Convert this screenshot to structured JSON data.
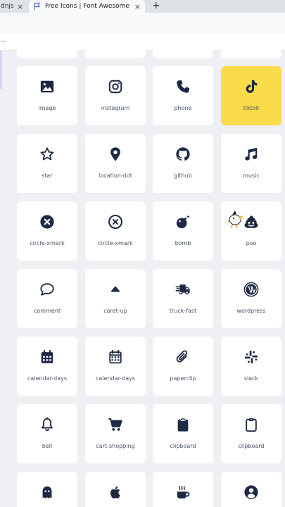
{
  "browser": {
    "prev_tab_label": "dnjs",
    "active_tab_title": "Free Icons | Font Awesome",
    "address_text": "...",
    "close_glyph": "×",
    "new_tab_glyph": "+"
  },
  "icons": [
    {
      "label": "image",
      "icon": "image-icon"
    },
    {
      "label": "instagram",
      "icon": "instagram-icon"
    },
    {
      "label": "phone",
      "icon": "phone-icon"
    },
    {
      "label": "tiktok",
      "icon": "tiktok-icon",
      "highlighted": true
    },
    {
      "label": "star",
      "icon": "star-icon"
    },
    {
      "label": "location-dot",
      "icon": "location-dot-icon"
    },
    {
      "label": "github",
      "icon": "github-icon"
    },
    {
      "label": "music",
      "icon": "music-icon"
    },
    {
      "label": "circle-xmark",
      "icon": "circle-xmark-solid-icon"
    },
    {
      "label": "circle-xmark",
      "icon": "circle-xmark-regular-icon"
    },
    {
      "label": "bomb",
      "icon": "bomb-icon"
    },
    {
      "label": "poo",
      "icon": "poo-icon"
    },
    {
      "label": "comment",
      "icon": "comment-icon"
    },
    {
      "label": "caret-up",
      "icon": "caret-up-icon"
    },
    {
      "label": "truck-fast",
      "icon": "truck-fast-icon"
    },
    {
      "label": "wordpress",
      "icon": "wordpress-icon"
    },
    {
      "label": "calendar-days",
      "icon": "calendar-days-solid-icon"
    },
    {
      "label": "calendar-days",
      "icon": "calendar-days-regular-icon"
    },
    {
      "label": "paperclip",
      "icon": "paperclip-icon"
    },
    {
      "label": "slack",
      "icon": "slack-icon"
    },
    {
      "label": "bell",
      "icon": "bell-icon"
    },
    {
      "label": "cart-shopping",
      "icon": "cart-shopping-icon"
    },
    {
      "label": "clipboard",
      "icon": "clipboard-solid-icon"
    },
    {
      "label": "clipboard",
      "icon": "clipboard-regular-icon"
    },
    {
      "label": "",
      "icon": "ghost-icon"
    },
    {
      "label": "",
      "icon": "apple-icon"
    },
    {
      "label": "",
      "icon": "mug-hot-icon"
    },
    {
      "label": "",
      "icon": "circle-user-icon"
    }
  ],
  "colors": {
    "icon": "#1e2a44",
    "highlight": "#fadc4b",
    "label": "#4a5566",
    "background": "#eef0f4"
  }
}
